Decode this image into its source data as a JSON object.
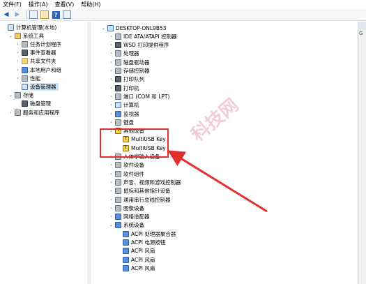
{
  "menu": [
    "文件(F)",
    "操作(A)",
    "查看(V)",
    "帮助(H)"
  ],
  "toolbar_icons": [
    "back-arrow-icon",
    "forward-arrow-icon",
    "console-tree-icon",
    "properties-icon",
    "help-icon",
    "panel-icon"
  ],
  "left_tree": [
    {
      "label": "计算机管理(本地)",
      "indent": 0,
      "twisty": "",
      "icon": "comp"
    },
    {
      "label": "系统工具",
      "indent": 1,
      "twisty": "v",
      "icon": "tool"
    },
    {
      "label": "任务计划程序",
      "indent": 2,
      "twisty": ">",
      "icon": "gray"
    },
    {
      "label": "事件查看器",
      "indent": 2,
      "twisty": ">",
      "icon": "dark"
    },
    {
      "label": "共享文件夹",
      "indent": 2,
      "twisty": ">",
      "icon": "folder"
    },
    {
      "label": "本地用户和组",
      "indent": 2,
      "twisty": ">",
      "icon": "blue"
    },
    {
      "label": "性能",
      "indent": 2,
      "twisty": ">",
      "icon": "gray"
    },
    {
      "label": "设备管理器",
      "indent": 2,
      "twisty": "",
      "icon": "comp",
      "selected": true
    },
    {
      "label": "存储",
      "indent": 1,
      "twisty": "v",
      "icon": "gray"
    },
    {
      "label": "磁盘管理",
      "indent": 2,
      "twisty": "",
      "icon": "dark"
    },
    {
      "label": "服务和应用程序",
      "indent": 1,
      "twisty": ">",
      "icon": "gray"
    }
  ],
  "device_tree": [
    {
      "label": "DESKTOP-ONL9B53",
      "indent": 0,
      "twisty": "v",
      "icon": "comp"
    },
    {
      "label": "IDE ATA/ATAPI 控制器",
      "indent": 1,
      "twisty": ">",
      "icon": "gray"
    },
    {
      "label": "WSD 打印提供程序",
      "indent": 1,
      "twisty": ">",
      "icon": "dark"
    },
    {
      "label": "处理器",
      "indent": 1,
      "twisty": ">",
      "icon": "gray"
    },
    {
      "label": "磁盘驱动器",
      "indent": 1,
      "twisty": ">",
      "icon": "gray"
    },
    {
      "label": "存储控制器",
      "indent": 1,
      "twisty": ">",
      "icon": "gray"
    },
    {
      "label": "打印队列",
      "indent": 1,
      "twisty": ">",
      "icon": "dark"
    },
    {
      "label": "打印机",
      "indent": 1,
      "twisty": ">",
      "icon": "dark"
    },
    {
      "label": "端口 (COM 和 LPT)",
      "indent": 1,
      "twisty": ">",
      "icon": "gray"
    },
    {
      "label": "计算机",
      "indent": 1,
      "twisty": ">",
      "icon": "comp"
    },
    {
      "label": "监视器",
      "indent": 1,
      "twisty": ">",
      "icon": "blue"
    },
    {
      "label": "键盘",
      "indent": 1,
      "twisty": ">",
      "icon": "gray"
    },
    {
      "label": "其他设备",
      "indent": 1,
      "twisty": "v",
      "icon": "warn"
    },
    {
      "label": "MultiUSB Key",
      "indent": 2,
      "twisty": "",
      "icon": "warn"
    },
    {
      "label": "MultiUSB Key",
      "indent": 2,
      "twisty": "",
      "icon": "warn"
    },
    {
      "label": "人体学输入设备",
      "indent": 1,
      "twisty": ">",
      "icon": "gray"
    },
    {
      "label": "软件设备",
      "indent": 1,
      "twisty": ">",
      "icon": "gray"
    },
    {
      "label": "软件组件",
      "indent": 1,
      "twisty": ">",
      "icon": "gray"
    },
    {
      "label": "声音、视频和游戏控制器",
      "indent": 1,
      "twisty": ">",
      "icon": "gray"
    },
    {
      "label": "鼠标和其他指针设备",
      "indent": 1,
      "twisty": ">",
      "icon": "gray"
    },
    {
      "label": "通用串行总线控制器",
      "indent": 1,
      "twisty": ">",
      "icon": "gray"
    },
    {
      "label": "图像设备",
      "indent": 1,
      "twisty": ">",
      "icon": "gray"
    },
    {
      "label": "网络适配器",
      "indent": 1,
      "twisty": ">",
      "icon": "blue"
    },
    {
      "label": "系统设备",
      "indent": 1,
      "twisty": "v",
      "icon": "blue"
    },
    {
      "label": "ACPI 处理器聚合器",
      "indent": 2,
      "twisty": "",
      "icon": "blue"
    },
    {
      "label": "ACPI 电源按钮",
      "indent": 2,
      "twisty": "",
      "icon": "blue"
    },
    {
      "label": "ACPI 风扇",
      "indent": 2,
      "twisty": "",
      "icon": "blue"
    },
    {
      "label": "ACPI 风扇",
      "indent": 2,
      "twisty": "",
      "icon": "blue"
    },
    {
      "label": "ACPI 风扇",
      "indent": 2,
      "twisty": "",
      "icon": "blue"
    }
  ],
  "actions_panel": {
    "header": "",
    "item": "G"
  },
  "watermark": "科技网"
}
